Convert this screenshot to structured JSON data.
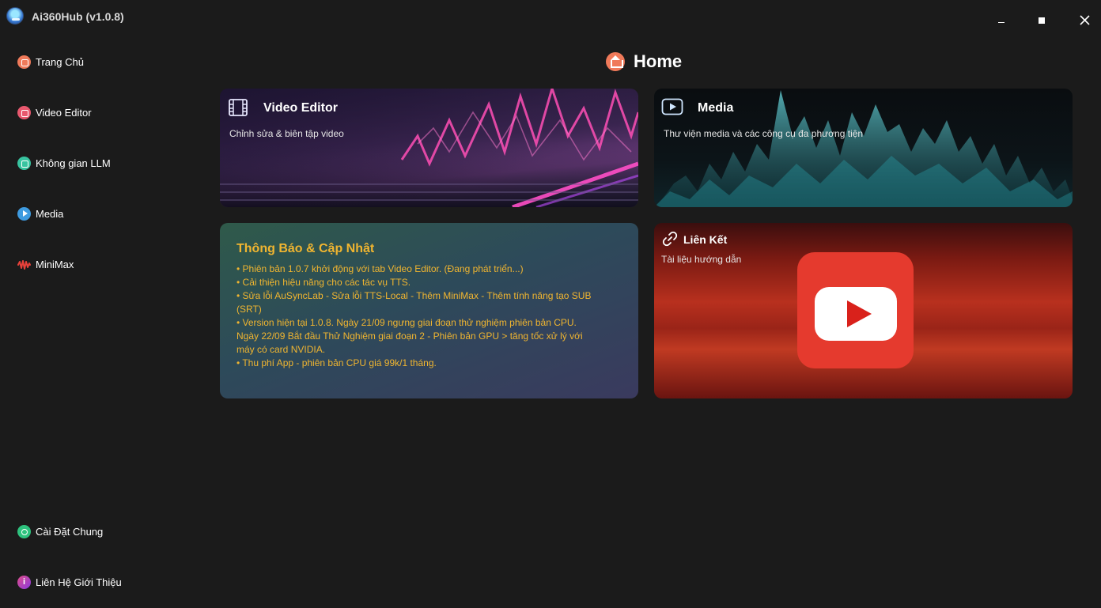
{
  "window": {
    "title": "Ai360Hub (v1.0.8)",
    "close_glyph": "✕"
  },
  "sidebar": {
    "items": [
      {
        "label": "Trang Chủ",
        "icon": "home-icon",
        "color": "#f07a5a"
      },
      {
        "label": "Video Editor",
        "icon": "video-icon",
        "color": "#e8586e"
      },
      {
        "label": "Không gian LLM",
        "icon": "llm-icon",
        "color": "#38c4a0"
      },
      {
        "label": "Media",
        "icon": "play-icon",
        "color": "#3e9be0"
      },
      {
        "label": "MiniMax",
        "icon": "waveform-icon",
        "color": "#e8413a"
      }
    ],
    "bottom_items": [
      {
        "label": "Cài Đặt Chung",
        "icon": "settings-icon",
        "color": "#2ec27e"
      },
      {
        "label": "Liên Hệ  Giới Thiệu",
        "icon": "info-icon",
        "color": "#c54ab8"
      }
    ]
  },
  "main": {
    "title": "Home",
    "cards": {
      "video_editor": {
        "title": "Video Editor",
        "subtitle": "Chỉnh sửa & biên tập video"
      },
      "media": {
        "title": "Media",
        "subtitle": "Thư viện media và các công cụ đa phương tiện"
      },
      "notice": {
        "title": "Thông Báo & Cập Nhật",
        "lines": [
          "• Phiên bản 1.0.7 khởi động với tab Video Editor. (Đang phát triển...)",
          "• Cải thiện hiệu năng cho các tác vụ TTS.",
          "• Sửa lỗi AuSyncLab - Sửa lỗi TTS-Local - Thêm MiniMax - Thêm tính năng tạo SUB",
          "(SRT)",
          "• Version hiện tại 1.0.8. Ngày 21/09 ngưng giai đoạn thử nghiệm phiên bản CPU.",
          "Ngày 22/09 Bắt đầu Thử Nghiệm giai đoạn 2 - Phiên bản GPU > tăng tốc xử lý với",
          "máy có card NVIDIA.",
          "• Thu phí App - phiên bản CPU giá 99k/1 tháng."
        ]
      },
      "links": {
        "title": "Liên Kết",
        "subtitle": "Tài liệu hướng dẫn"
      }
    }
  }
}
